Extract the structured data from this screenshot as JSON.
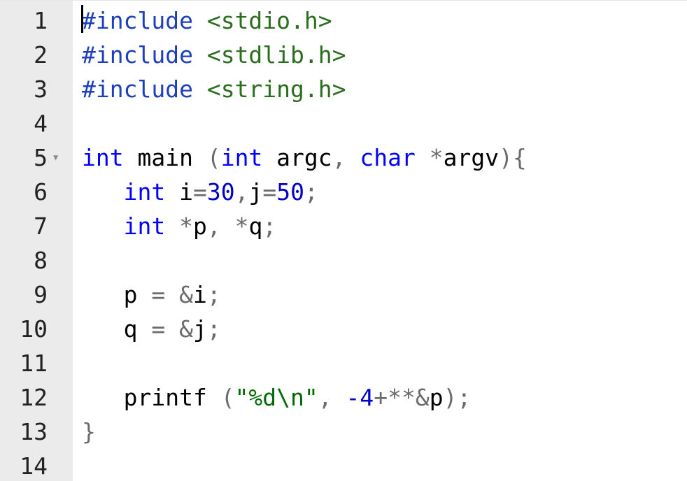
{
  "lines": [
    {
      "n": "1",
      "tokens": [
        {
          "t": "#include",
          "c": "inc"
        },
        {
          "t": " ",
          "c": ""
        },
        {
          "t": "<stdio.h>",
          "c": "hdr"
        }
      ]
    },
    {
      "n": "2",
      "tokens": [
        {
          "t": "#include",
          "c": "inc"
        },
        {
          "t": " ",
          "c": ""
        },
        {
          "t": "<stdlib.h>",
          "c": "hdr"
        }
      ]
    },
    {
      "n": "3",
      "tokens": [
        {
          "t": "#include",
          "c": "inc"
        },
        {
          "t": " ",
          "c": ""
        },
        {
          "t": "<string.h>",
          "c": "hdr"
        }
      ]
    },
    {
      "n": "4",
      "tokens": []
    },
    {
      "n": "5",
      "fold": true,
      "tokens": [
        {
          "t": "int",
          "c": "kw"
        },
        {
          "t": " main ",
          "c": ""
        },
        {
          "t": "(",
          "c": "op"
        },
        {
          "t": "int",
          "c": "kw"
        },
        {
          "t": " argc",
          "c": ""
        },
        {
          "t": ", ",
          "c": "op"
        },
        {
          "t": "char",
          "c": "kw"
        },
        {
          "t": " ",
          "c": ""
        },
        {
          "t": "*",
          "c": "op"
        },
        {
          "t": "argv",
          "c": ""
        },
        {
          "t": "){",
          "c": "op"
        }
      ]
    },
    {
      "n": "6",
      "tokens": [
        {
          "t": "   ",
          "c": ""
        },
        {
          "t": "int",
          "c": "kw"
        },
        {
          "t": " i",
          "c": ""
        },
        {
          "t": "=",
          "c": "op"
        },
        {
          "t": "30",
          "c": "num-lit"
        },
        {
          "t": ",",
          "c": "op"
        },
        {
          "t": "j",
          "c": ""
        },
        {
          "t": "=",
          "c": "op"
        },
        {
          "t": "50",
          "c": "num-lit"
        },
        {
          "t": ";",
          "c": "op"
        }
      ]
    },
    {
      "n": "7",
      "tokens": [
        {
          "t": "   ",
          "c": ""
        },
        {
          "t": "int",
          "c": "kw"
        },
        {
          "t": " ",
          "c": ""
        },
        {
          "t": "*",
          "c": "op"
        },
        {
          "t": "p",
          "c": ""
        },
        {
          "t": ", ",
          "c": "op"
        },
        {
          "t": "*",
          "c": "op"
        },
        {
          "t": "q",
          "c": ""
        },
        {
          "t": ";",
          "c": "op"
        }
      ]
    },
    {
      "n": "8",
      "tokens": []
    },
    {
      "n": "9",
      "tokens": [
        {
          "t": "   p ",
          "c": ""
        },
        {
          "t": "=",
          "c": "op"
        },
        {
          "t": " ",
          "c": ""
        },
        {
          "t": "&",
          "c": "op"
        },
        {
          "t": "i",
          "c": ""
        },
        {
          "t": ";",
          "c": "op"
        }
      ]
    },
    {
      "n": "10",
      "tokens": [
        {
          "t": "   q ",
          "c": ""
        },
        {
          "t": "=",
          "c": "op"
        },
        {
          "t": " ",
          "c": ""
        },
        {
          "t": "&",
          "c": "op"
        },
        {
          "t": "j",
          "c": ""
        },
        {
          "t": ";",
          "c": "op"
        }
      ]
    },
    {
      "n": "11",
      "tokens": []
    },
    {
      "n": "12",
      "tokens": [
        {
          "t": "   printf ",
          "c": ""
        },
        {
          "t": "(",
          "c": "op"
        },
        {
          "t": "\"%d",
          "c": "str"
        },
        {
          "t": "\\n",
          "c": "esc"
        },
        {
          "t": "\"",
          "c": "str"
        },
        {
          "t": ", ",
          "c": "op"
        },
        {
          "t": "-4",
          "c": "num-lit"
        },
        {
          "t": "+**",
          "c": "op"
        },
        {
          "t": "&",
          "c": "op"
        },
        {
          "t": "p",
          "c": ""
        },
        {
          "t": ");",
          "c": "op"
        }
      ]
    },
    {
      "n": "13",
      "tokens": [
        {
          "t": "}",
          "c": "op"
        }
      ]
    },
    {
      "n": "14",
      "tokens": []
    }
  ],
  "fold_icon": "fold-triangle-icon"
}
